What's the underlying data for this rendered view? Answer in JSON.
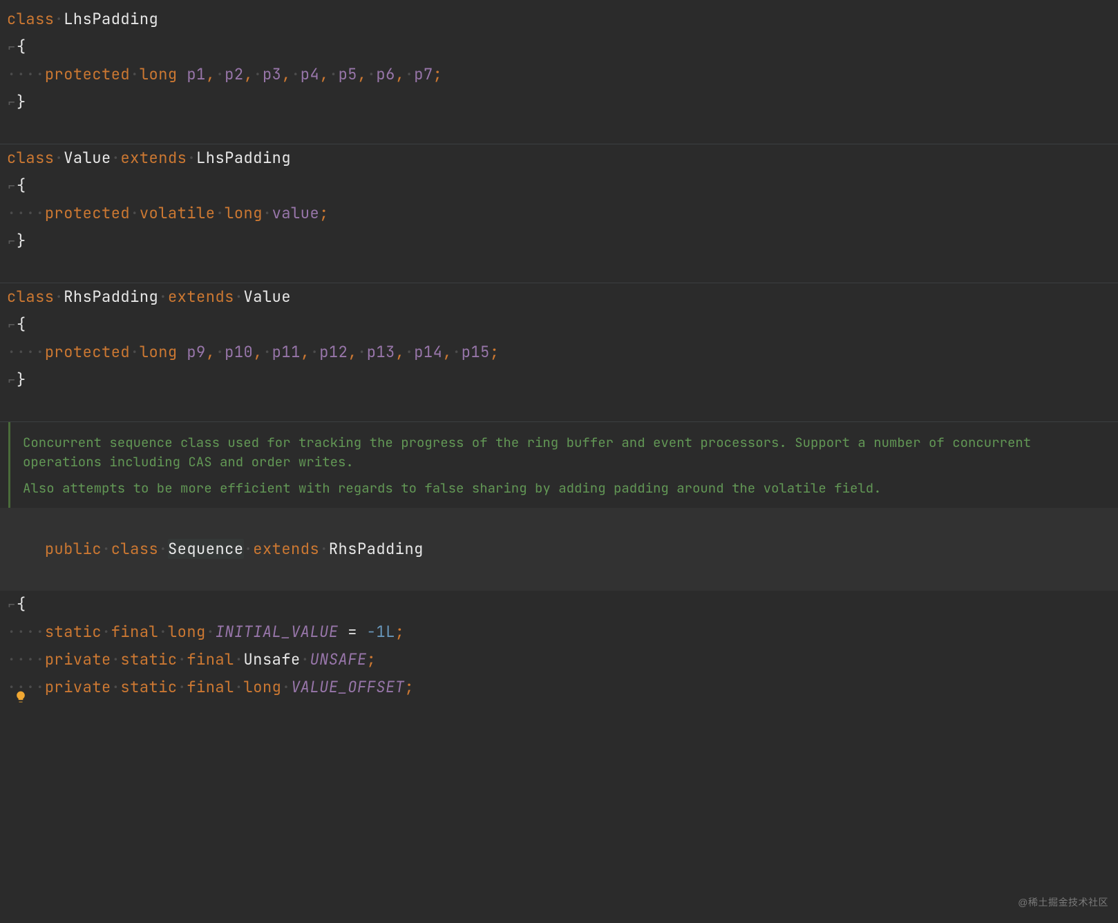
{
  "tokens": {
    "kw_class": "class",
    "kw_extends": "extends",
    "kw_public": "public",
    "kw_protected": "protected",
    "kw_private": "private",
    "kw_static": "static",
    "kw_final": "final",
    "kw_volatile": "volatile",
    "kw_long": "long",
    "ws4": "····",
    "dot": "·",
    "fold_open": "⌐",
    "fold_close": "⌐"
  },
  "class1": {
    "name": "LhsPadding",
    "fields": [
      "p1",
      "p2",
      "p3",
      "p4",
      "p5",
      "p6",
      "p7"
    ]
  },
  "class2": {
    "name": "Value",
    "extends": "LhsPadding",
    "field": "value"
  },
  "class3": {
    "name": "RhsPadding",
    "extends": "Value",
    "fields": [
      "p9",
      "p10",
      "p11",
      "p12",
      "p13",
      "p14",
      "p15"
    ]
  },
  "doc": {
    "p1": "Concurrent sequence class used for tracking the progress of the ring buffer and event processors. Support a number of concurrent operations including CAS and order writes.",
    "p2": "Also attempts to be more efficient with regards to false sharing by adding padding around the volatile field."
  },
  "class4": {
    "name": "Sequence",
    "extends": "RhsPadding",
    "const1": {
      "type": "long",
      "name": "INITIAL_VALUE",
      "value": "-1L"
    },
    "const2": {
      "type": "Unsafe",
      "name": "UNSAFE"
    },
    "const3": {
      "type": "long",
      "name": "VALUE_OFFSET"
    }
  },
  "watermark": "@稀土掘金技术社区"
}
